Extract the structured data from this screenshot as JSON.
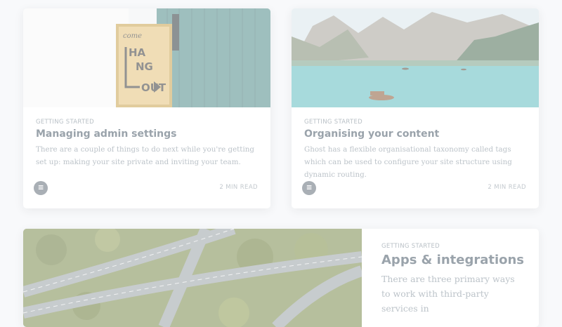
{
  "posts": [
    {
      "tag": "Getting Started",
      "title": "Managing admin settings",
      "excerpt": "There are a couple of things to do next while you're getting set up: making your site private and inviting your team.",
      "reading_time": "2 MIN READ",
      "author_avatar_glyph": "𝌆",
      "image_icon": "come-hang-out-sign-image"
    },
    {
      "tag": "Getting Started",
      "title": "Organising your content",
      "excerpt": "Ghost has a flexible organisational taxonomy called tags which can be used to configure your site structure using dynamic routing.",
      "reading_time": "2 MIN READ",
      "author_avatar_glyph": "𝌆",
      "image_icon": "mountain-lake-image"
    },
    {
      "tag": "Getting Started",
      "title": "Apps & integrations",
      "excerpt_visible": "There are three primary ways to work with third-party services in",
      "image_icon": "highway-interchange-image"
    }
  ]
}
